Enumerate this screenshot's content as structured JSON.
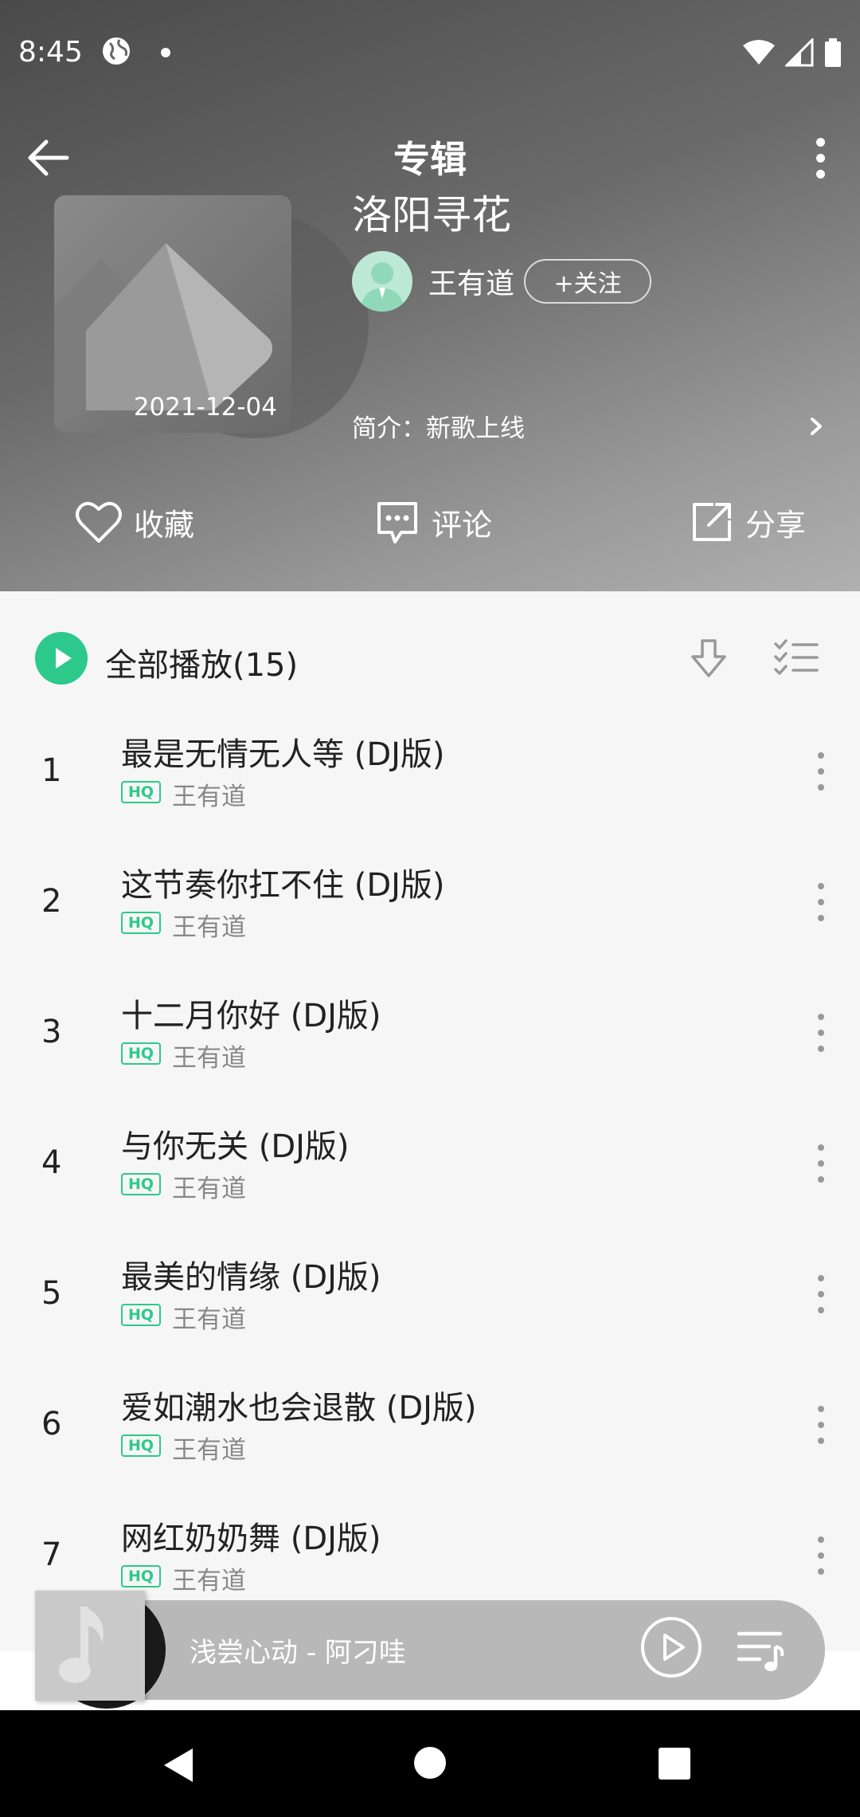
{
  "status_bar": {
    "time": "8:45"
  },
  "header": {
    "title": "专辑",
    "album_name": "洛阳寻花",
    "release_date": "2021-12-04",
    "artist": "王有道",
    "follow_label": "+关注",
    "intro": "简介：新歌上线"
  },
  "actions": {
    "collect": "收藏",
    "comment": "评论",
    "share": "分享"
  },
  "list": {
    "play_all": "全部播放(15)",
    "songs": [
      {
        "no": "1",
        "title": "最是无情无人等 (DJ版)",
        "badge": "HQ",
        "artist": "王有道"
      },
      {
        "no": "2",
        "title": "这节奏你扛不住 (DJ版)",
        "badge": "HQ",
        "artist": "王有道"
      },
      {
        "no": "3",
        "title": "十二月你好 (DJ版)",
        "badge": "HQ",
        "artist": "王有道"
      },
      {
        "no": "4",
        "title": "与你无关 (DJ版)",
        "badge": "HQ",
        "artist": "王有道"
      },
      {
        "no": "5",
        "title": "最美的情缘 (DJ版)",
        "badge": "HQ",
        "artist": "王有道"
      },
      {
        "no": "6",
        "title": "爱如潮水也会退散 (DJ版)",
        "badge": "HQ",
        "artist": "王有道"
      },
      {
        "no": "7",
        "title": "网红奶奶舞 (DJ版)",
        "badge": "HQ",
        "artist": "王有道"
      }
    ]
  },
  "player": {
    "now_playing": "浅尝心动 - 阿刁哇"
  },
  "colors": {
    "accent": "#2dc98b",
    "navbar": "#000000"
  }
}
